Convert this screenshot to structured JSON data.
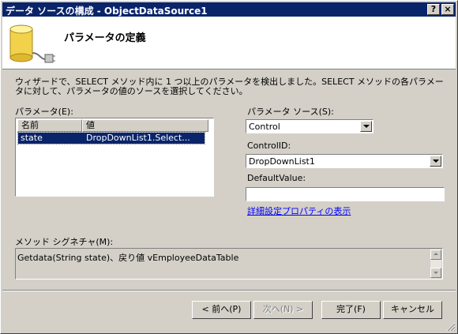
{
  "window": {
    "title": "データ ソースの構成 - ObjectDataSource1",
    "help_glyph": "?",
    "close_glyph": "×"
  },
  "header": {
    "title": "パラメータの定義",
    "icon": "database-plug-icon"
  },
  "description": "ウィザードで、SELECT メソッド内に 1 つ以上のパラメータを検出しました。SELECT メソッドの各パラメータに対して、パラメータの値のソースを選択してください。",
  "parameters": {
    "label": "パラメータ(E):",
    "columns": [
      "名前",
      "値"
    ],
    "rows": [
      {
        "name": "state",
        "value": "DropDownList1.Select..."
      }
    ]
  },
  "param_source": {
    "label": "パラメータ ソース(S):",
    "value": "Control"
  },
  "control_id": {
    "label": "ControlID:",
    "value": "DropDownList1"
  },
  "default_value": {
    "label": "DefaultValue:",
    "value": ""
  },
  "advanced_link": "詳細設定プロパティの表示",
  "method_signature": {
    "label": "メソッド シグネチャ(M):",
    "value": "Getdata(String state)、戻り値 vEmployeeDataTable"
  },
  "buttons": {
    "back": "< 前へ(P)",
    "next": "次へ(N) >",
    "finish": "完了(F)",
    "cancel": "キャンセル"
  },
  "colors": {
    "titlebar": "#0a246a",
    "face": "#d4d0c8",
    "selection": "#0a246a",
    "link": "#0000ff"
  }
}
